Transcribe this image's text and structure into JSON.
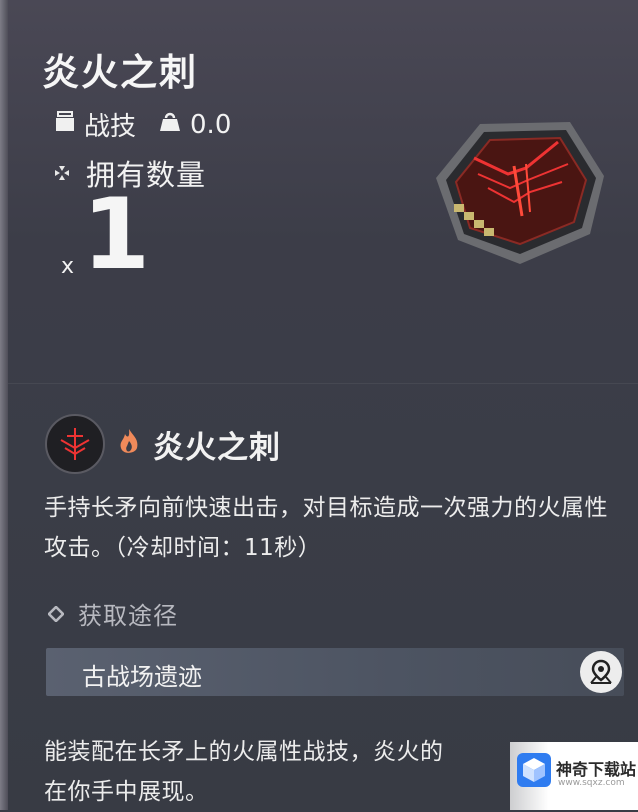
{
  "item": {
    "title": "炎火之刺",
    "type_label": "战技",
    "weight_value": "0.0",
    "owned_label": "拥有数量",
    "count_prefix": "x",
    "count": "1"
  },
  "skill": {
    "name": "炎火之刺",
    "element": "fire",
    "description": "手持长矛向前快速出击，对目标造成一次强力的火属性攻击。（冷却时间：11秒）"
  },
  "source": {
    "heading": "获取途径",
    "location": "古战场遗迹"
  },
  "flavor_text": "能装配在长矛上的火属性战技，炎火的",
  "flavor_text_2": "在你手中展现。",
  "watermark": {
    "name": "神奇下载站",
    "url": "www.sqxz.com"
  },
  "colors": {
    "accent_red": "#e0302c",
    "fire_orange": "#f08a5a",
    "watermark_blue": "#2f7cf0"
  }
}
